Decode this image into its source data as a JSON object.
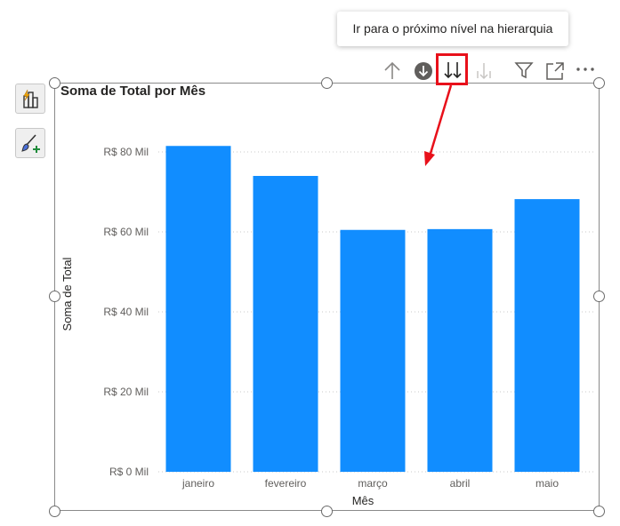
{
  "tooltip": {
    "text": "Ir para o próximo nível na hierarquia"
  },
  "side_toolbar": [
    {
      "name": "build-visual",
      "icon": "bar-chart-lightning-icon"
    },
    {
      "name": "format-visual",
      "icon": "paintbrush-plus-icon"
    }
  ],
  "visual_header": {
    "icons": [
      "drill-up-arrow-icon",
      "drill-down-mode-icon",
      "next-level-icon",
      "expand-next-level-icon",
      "filter-icon",
      "focus-mode-icon",
      "more-options-icon"
    ],
    "highlight_color": "#E8101A"
  },
  "colors": {
    "bar": "#118DFF",
    "annotation": "#E8101A",
    "grid": "#C8C8C8",
    "axis_text": "#605E5C"
  },
  "chart_data": {
    "type": "bar",
    "title": "Soma de Total por Mês",
    "xlabel": "Mês",
    "ylabel": "Soma de Total",
    "categories": [
      "janeiro",
      "fevereiro",
      "março",
      "abril",
      "maio"
    ],
    "values": [
      81500,
      74000,
      60500,
      60700,
      68200
    ],
    "ylim": [
      0,
      80000
    ],
    "yticks": [
      0,
      20000,
      40000,
      60000,
      80000
    ],
    "ytick_labels": [
      "R$ 0 Mil",
      "R$ 20 Mil",
      "R$ 40 Mil",
      "R$ 60 Mil",
      "R$ 80 Mil"
    ],
    "grid": true,
    "legend": "none"
  }
}
